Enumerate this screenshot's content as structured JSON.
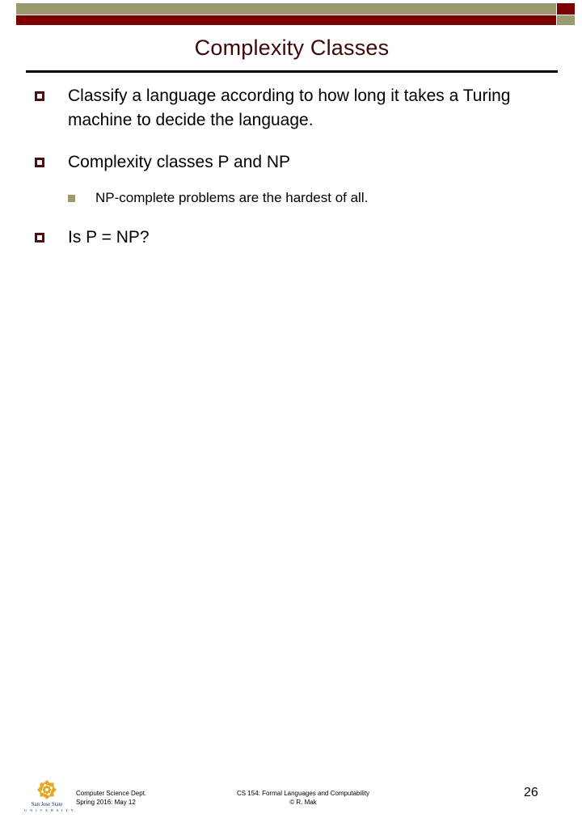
{
  "slide": {
    "title": "Complexity Classes",
    "page_number": "26",
    "colors": {
      "bar_khaki": "#9a9a6e",
      "bar_maroon": "#7d0000",
      "title_text": "#3d0808",
      "bullet_l1_marker": "#4a1010",
      "bullet_l2_marker": "#9a9a6e",
      "body_text": "#000000",
      "logo_gold": "#e5a823",
      "logo_blue": "#14365c"
    },
    "bullets": [
      {
        "level": 1,
        "marker": "hollow-square-bullet-icon",
        "text": "Classify a language according to how long it takes a Turing machine to decide the language."
      },
      {
        "level": 1,
        "marker": "hollow-square-bullet-icon",
        "text": "Complexity classes P and NP"
      },
      {
        "level": 2,
        "marker": "filled-square-bullet-icon",
        "text": "NP-complete problems are the hardest of all."
      },
      {
        "level": 1,
        "marker": "hollow-square-bullet-icon",
        "text": "Is P = NP?"
      }
    ]
  },
  "footer": {
    "logo": {
      "icon": "sjsu-rosette-logo-icon",
      "name": "San Jose State",
      "subtitle": "U N I V E R S I T Y"
    },
    "left_line1": "Computer Science Dept.",
    "left_line2": "Spring 2016: May 12",
    "center_line1": "CS 154: Formal Languages and Computability",
    "center_line2": "© R. Mak",
    "page_number": "26"
  }
}
